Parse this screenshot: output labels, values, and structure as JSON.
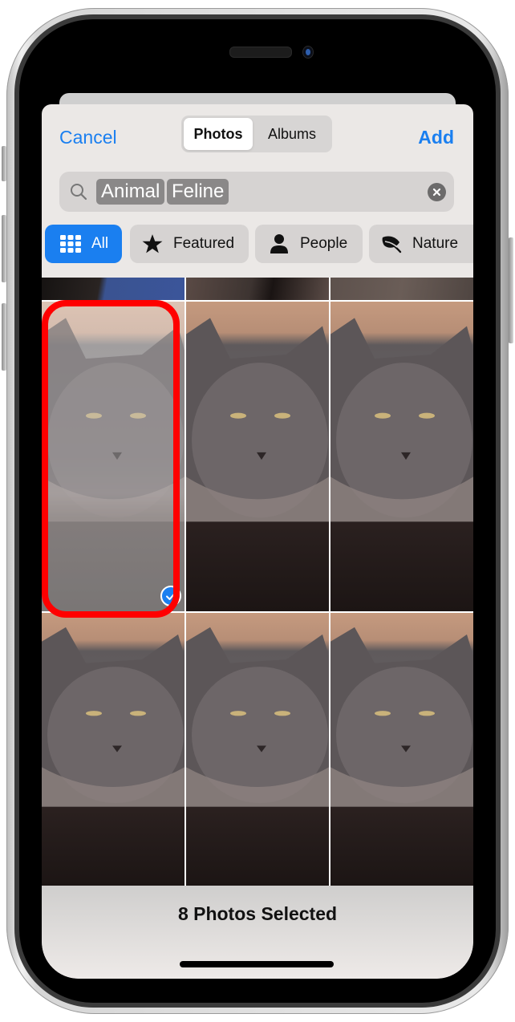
{
  "header": {
    "cancel_label": "Cancel",
    "add_label": "Add",
    "segments": [
      {
        "label": "Photos",
        "active": true
      },
      {
        "label": "Albums",
        "active": false
      }
    ]
  },
  "search": {
    "icon": "search-icon",
    "tokens": [
      "Animal",
      "Feline"
    ],
    "clear_icon": "clear-icon"
  },
  "filters": [
    {
      "label": "All",
      "icon": "grid-icon",
      "active": true
    },
    {
      "label": "Featured",
      "icon": "star-icon",
      "active": false
    },
    {
      "label": "People",
      "icon": "person-icon",
      "active": false
    },
    {
      "label": "Nature",
      "icon": "leaf-icon",
      "active": false
    }
  ],
  "grid": {
    "rows_visible": 3,
    "columns": 3,
    "photos": [
      {
        "subject": "cat",
        "row": "partial-top",
        "selected": false
      },
      {
        "subject": "cat",
        "row": "partial-top",
        "selected": false
      },
      {
        "subject": "cat",
        "row": "partial-top",
        "selected": false
      },
      {
        "subject": "gray cat",
        "row": 1,
        "selected": true,
        "highlighted": true
      },
      {
        "subject": "gray cat",
        "row": 1,
        "selected": false
      },
      {
        "subject": "gray cat",
        "row": 1,
        "selected": false
      },
      {
        "subject": "gray cat",
        "row": 2,
        "selected": false
      },
      {
        "subject": "gray cat",
        "row": 2,
        "selected": false
      },
      {
        "subject": "gray cat",
        "row": 2,
        "selected": false
      }
    ]
  },
  "footer": {
    "selection_label": "8 Photos Selected"
  },
  "colors": {
    "accent": "#1a7ff0",
    "highlight": "#ff0000"
  }
}
